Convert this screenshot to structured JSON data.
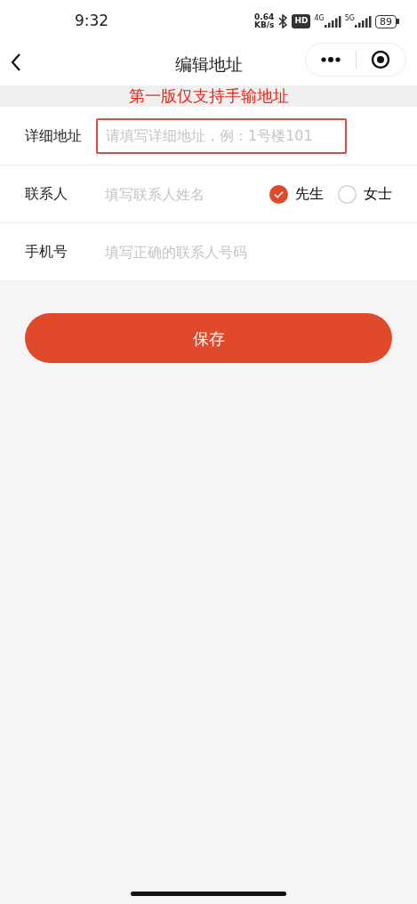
{
  "status_bar": {
    "time": "9:32",
    "net_speed": "0.64",
    "net_unit": "KB/s",
    "hd": "HD",
    "networks": [
      "4G",
      "5G"
    ],
    "battery": "89"
  },
  "nav": {
    "title": "编辑地址"
  },
  "notice": "第一版仅支持手输地址",
  "fields": [
    {
      "kind": "text",
      "label": "详细地址",
      "placeholder": "请填写详细地址，例：1号楼101",
      "highlighted": true
    },
    {
      "kind": "gender",
      "label": "联系人",
      "placeholder": "填写联系人姓名",
      "highlighted": false,
      "options": [
        {
          "label": "先生",
          "selected": true
        },
        {
          "label": "女士",
          "selected": false
        }
      ]
    },
    {
      "kind": "text",
      "label": "手机号",
      "placeholder": "填写正确的联系人号码",
      "highlighted": false
    }
  ],
  "save_button": "保存"
}
